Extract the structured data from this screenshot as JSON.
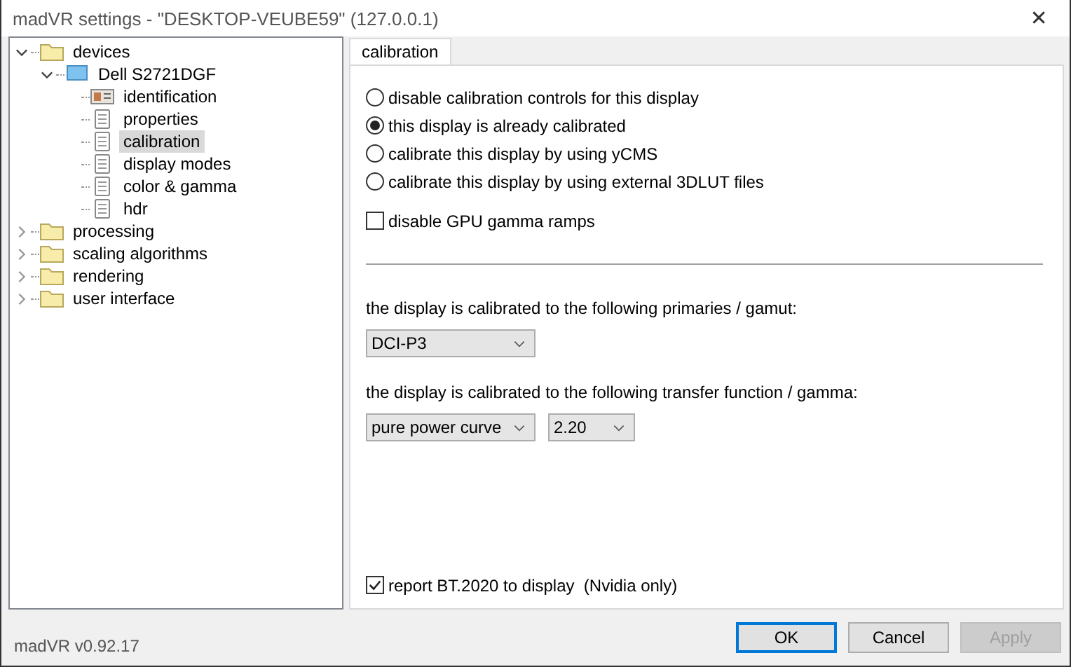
{
  "window": {
    "title": "madVR settings - \"DESKTOP-VEUBE59\" (127.0.0.1)",
    "close": "✕"
  },
  "tree": [
    {
      "label": "devices",
      "kind": "folder",
      "expanded": true,
      "selected": false,
      "children": [
        {
          "label": "Dell S2721DGF",
          "kind": "monitor",
          "expanded": true,
          "selected": false,
          "children": [
            {
              "label": "identification",
              "kind": "idcard",
              "selected": false
            },
            {
              "label": "properties",
              "kind": "page",
              "selected": false
            },
            {
              "label": "calibration",
              "kind": "page",
              "selected": true
            },
            {
              "label": "display modes",
              "kind": "page",
              "selected": false
            },
            {
              "label": "color & gamma",
              "kind": "page",
              "selected": false
            },
            {
              "label": "hdr",
              "kind": "page",
              "selected": false
            }
          ]
        }
      ]
    },
    {
      "label": "processing",
      "kind": "folder",
      "expanded": false,
      "selected": false
    },
    {
      "label": "scaling algorithms",
      "kind": "folder",
      "expanded": false,
      "selected": false
    },
    {
      "label": "rendering",
      "kind": "folder",
      "expanded": false,
      "selected": false
    },
    {
      "label": "user interface",
      "kind": "folder",
      "expanded": false,
      "selected": false
    }
  ],
  "tabs": [
    {
      "label": "calibration",
      "selected": true
    }
  ],
  "radios": [
    {
      "label": "disable calibration controls for this display",
      "selected": false
    },
    {
      "label": "this display is already calibrated",
      "selected": true
    },
    {
      "label": "calibrate this display by using yCMS",
      "selected": false
    },
    {
      "label": "calibrate this display by using external 3DLUT files",
      "selected": false
    }
  ],
  "gpu_checkbox": {
    "label": "disable GPU gamma ramps",
    "checked": false
  },
  "gamut": {
    "label": "the display is calibrated to the following primaries / gamut:",
    "dropdowns": [
      {
        "value": "DCI-P3"
      }
    ]
  },
  "transfer": {
    "label": "the display is calibrated to the following transfer function / gamma:",
    "dropdowns": [
      {
        "value": "pure power curve"
      },
      {
        "value": "2.20"
      }
    ]
  },
  "bt2020_checkbox": {
    "label": "report BT.2020 to display  (Nvidia only)",
    "checked": true
  },
  "version": "madVR v0.92.17",
  "buttons": [
    {
      "label": "OK",
      "kind": "default",
      "disabled": false
    },
    {
      "label": "Cancel",
      "kind": "normal",
      "disabled": false
    },
    {
      "label": "Apply",
      "kind": "normal",
      "disabled": true
    }
  ]
}
